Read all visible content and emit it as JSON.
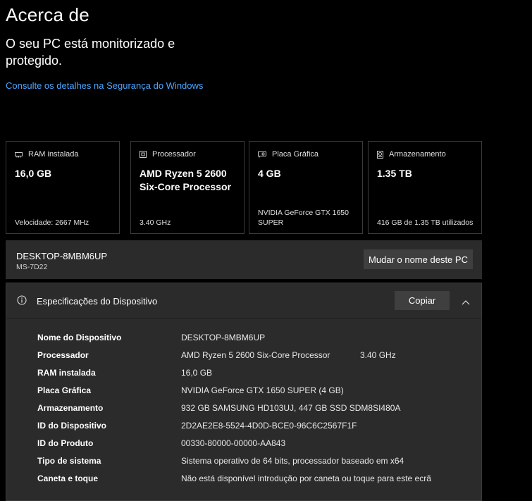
{
  "page": {
    "title": "Acerca de",
    "status": "O seu PC está monitorizado e protegido.",
    "security_link": "Consulte os detalhes na Segurança do Windows"
  },
  "cards": [
    {
      "label": "RAM instalada",
      "icon": "ram-icon",
      "value": "16,0 GB",
      "detail": "Velocidade: 2667 MHz"
    },
    {
      "label": "Processador",
      "icon": "cpu-icon",
      "value": "AMD Ryzen 5 2600 Six-Core Processor",
      "detail": "3.40 GHz"
    },
    {
      "label": "Placa Gráfica",
      "icon": "gpu-icon",
      "value": "4 GB",
      "detail": "NVIDIA GeForce GTX 1650 SUPER"
    },
    {
      "label": "Armazenamento",
      "icon": "storage-icon",
      "value": "1.35 TB",
      "detail": "416 GB de 1.35 TB utilizados"
    }
  ],
  "device": {
    "name": "DESKTOP-8MBM6UP",
    "model": "MS-7D22",
    "rename_label": "Mudar o nome deste PC"
  },
  "specs": {
    "title": "Especificações do Dispositivo",
    "copy_label": "Copiar",
    "rows": [
      {
        "key": "Nome do Dispositivo",
        "value": "DESKTOP-8MBM6UP",
        "extra": ""
      },
      {
        "key": "Processador",
        "value": "AMD Ryzen 5 2600 Six-Core Processor",
        "extra": "3.40 GHz"
      },
      {
        "key": "RAM instalada",
        "value": "16,0 GB",
        "extra": ""
      },
      {
        "key": "Placa Gráfica",
        "value": "NVIDIA GeForce GTX 1650 SUPER (4 GB)",
        "extra": ""
      },
      {
        "key": "Armazenamento",
        "value": "932 GB SAMSUNG HD103UJ, 447 GB SSD SDM8SI480A",
        "extra": ""
      },
      {
        "key": "ID do Dispositivo",
        "value": "2D2AE2E8-5524-4D0D-BCE0-96C6C2567F1F",
        "extra": ""
      },
      {
        "key": "ID do Produto",
        "value": "00330-80000-00000-AA843",
        "extra": ""
      },
      {
        "key": "Tipo de sistema",
        "value": "Sistema operativo de 64 bits, processador baseado em x64",
        "extra": ""
      },
      {
        "key": "Caneta e toque",
        "value": "Não está disponível introdução por caneta ou toque para este ecrã",
        "extra": ""
      }
    ]
  },
  "colors": {
    "background": "#000000",
    "panel": "#2b2b2b",
    "link": "#4ca6ff",
    "button": "#3f3f3f"
  }
}
